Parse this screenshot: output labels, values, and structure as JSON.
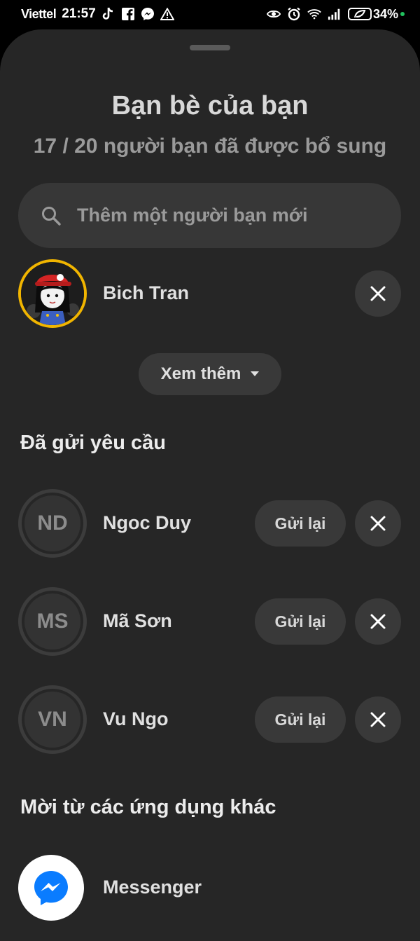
{
  "status_bar": {
    "carrier": "Viettel",
    "time": "21:57",
    "battery": "34%",
    "left_icons": [
      "tiktok-icon",
      "facebook-icon",
      "messenger-icon",
      "warning-icon"
    ],
    "right_icons": [
      "eye-icon",
      "alarm-icon",
      "wifi-icon",
      "signal-icon",
      "battery-icon"
    ]
  },
  "sheet": {
    "title": "Bạn bè của bạn",
    "subtitle": "17 / 20 người bạn đã được bổ sung"
  },
  "search": {
    "placeholder": "Thêm một người bạn mới",
    "value": ""
  },
  "friends": [
    {
      "name": "Bich Tran",
      "avatar": "photo"
    }
  ],
  "see_more_label": "Xem thêm",
  "sent_requests": {
    "title": "Đã gửi yêu cầu",
    "resend_label": "Gửi lại",
    "items": [
      {
        "initials": "ND",
        "name": "Ngoc Duy"
      },
      {
        "initials": "MS",
        "name": "Mã Sơn"
      },
      {
        "initials": "VN",
        "name": "Vu Ngo"
      }
    ]
  },
  "invite": {
    "title": "Mời từ các ứng dụng khác",
    "apps": [
      {
        "name": "Messenger",
        "icon": "messenger-icon",
        "color": "#0a7cff"
      }
    ]
  },
  "colors": {
    "sheet_bg": "#262626",
    "button_bg": "#393939",
    "avatar_ring": "#f1b500",
    "charging": "#21c25e"
  }
}
